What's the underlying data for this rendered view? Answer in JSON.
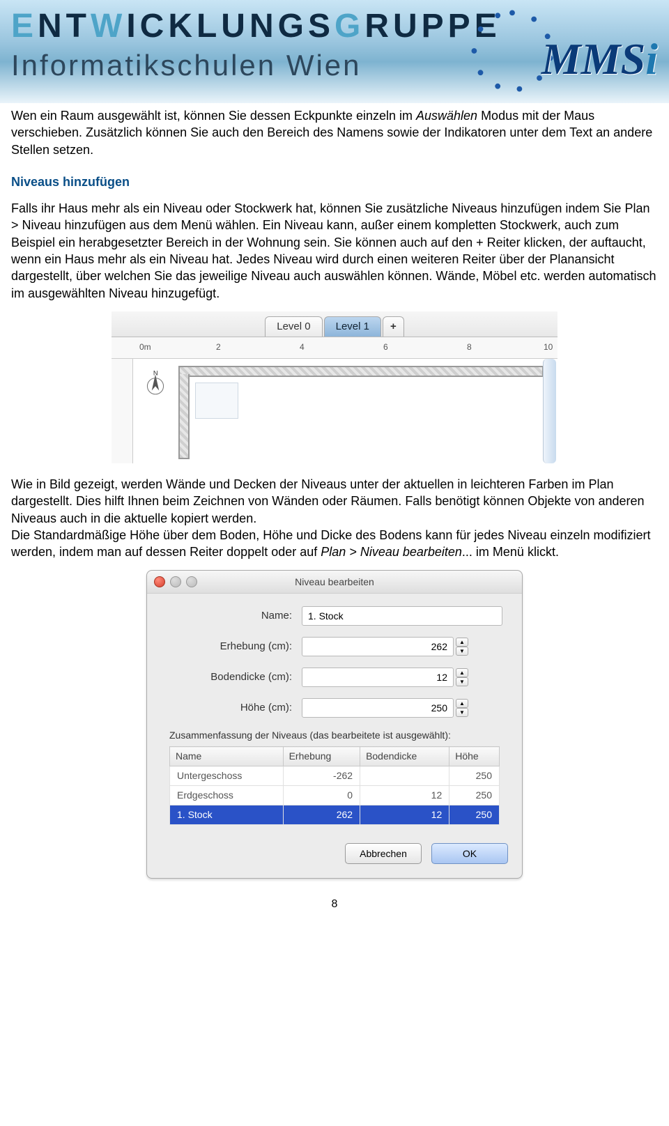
{
  "header": {
    "title_plain": "NTICKLUNGSRUPPE",
    "title_letters_light": [
      "E",
      "W",
      "G"
    ],
    "subtitle": "Informatikschulen Wien",
    "logo_text": "MMS",
    "logo_dot": "i"
  },
  "body": {
    "p1a": "Wen ein Raum ausgewählt ist, können Sie dessen Eckpunkte einzeln im ",
    "p1_em": "Auswählen",
    "p1b": " Modus mit der Maus verschieben. Zusätzlich können Sie auch den Bereich des Namens sowie der Indikatoren unter dem Text an andere Stellen setzen.",
    "h1": "Niveaus hinzufügen",
    "p2": "Falls ihr Haus mehr als ein Niveau oder Stockwerk hat, können Sie zusätzliche Niveaus hinzufügen indem Sie Plan > Niveau hinzufügen aus dem Menü wählen. Ein Niveau kann, außer einem kompletten Stockwerk, auch zum Beispiel ein herabgesetzter Bereich in der Wohnung sein. Sie können auch auf den + Reiter klicken, der auftaucht, wenn ein Haus mehr als ein Niveau hat. Jedes Niveau wird durch einen weiteren Reiter über der Planansicht dargestellt, über welchen Sie das jeweilige Niveau auch auswählen können. Wände, Möbel etc. werden automatisch im ausgewählten Niveau hinzugefügt.",
    "p3a": "Wie in Bild gezeigt, werden Wände und Decken der Niveaus unter der aktuellen in leichteren Farben im Plan dargestellt. Dies hilft Ihnen beim Zeichnen von Wänden oder Räumen. Falls benötigt können Objekte von anderen Niveaus auch in die aktuelle kopiert werden.",
    "p3b": "Die Standardmäßige Höhe über dem Boden, Höhe und Dicke des Bodens kann für jedes Niveau einzeln modifiziert werden, indem man auf dessen Reiter doppelt oder auf ",
    "p3_em": "Plan > Niveau bearbeiten",
    "p3c": "... im Menü klickt."
  },
  "shot1": {
    "tabs": [
      "Level 0",
      "Level 1",
      "+"
    ],
    "active_tab": 1,
    "ruler": [
      "0m",
      "2",
      "4",
      "6",
      "8",
      "10"
    ]
  },
  "dialog": {
    "title": "Niveau bearbeiten",
    "fields": {
      "name_label": "Name:",
      "name_value": "1. Stock",
      "elev_label": "Erhebung (cm):",
      "elev_value": "262",
      "thick_label": "Bodendicke (cm):",
      "thick_value": "12",
      "height_label": "Höhe (cm):",
      "height_value": "250"
    },
    "section": "Zusammenfassung der Niveaus (das bearbeitete ist ausgewählt):",
    "table": {
      "headers": [
        "Name",
        "Erhebung",
        "Bodendicke",
        "Höhe"
      ],
      "rows": [
        {
          "name": "Untergeschoss",
          "erhebung": "-262",
          "bodendicke": "",
          "hoehe": "250",
          "selected": false
        },
        {
          "name": "Erdgeschoss",
          "erhebung": "0",
          "bodendicke": "12",
          "hoehe": "250",
          "selected": false
        },
        {
          "name": "1. Stock",
          "erhebung": "262",
          "bodendicke": "12",
          "hoehe": "250",
          "selected": true
        }
      ]
    },
    "buttons": {
      "cancel": "Abbrechen",
      "ok": "OK"
    }
  },
  "page_number": "8"
}
